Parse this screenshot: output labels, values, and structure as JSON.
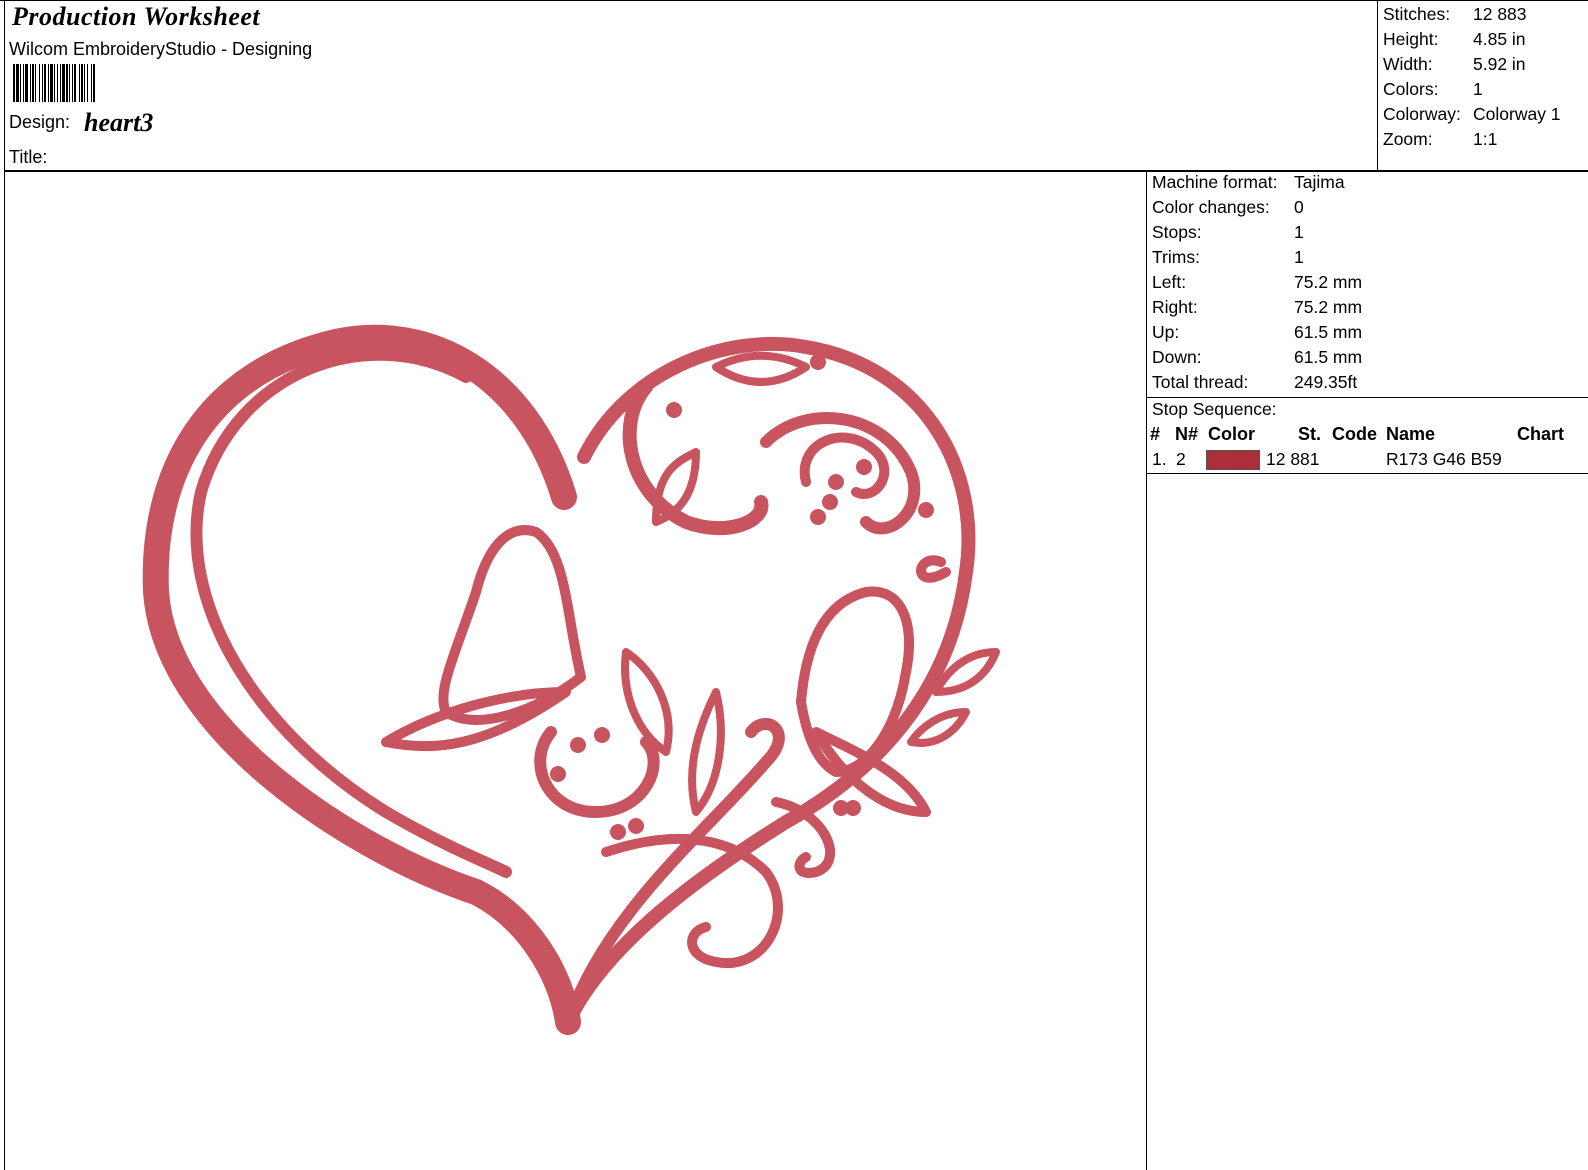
{
  "header": {
    "title": "Production Worksheet",
    "app": "Wilcom EmbroideryStudio - Designing",
    "design_label": "Design:",
    "design_value": "heart3",
    "title_label": "Title:"
  },
  "summary": [
    {
      "label": "Stitches:",
      "value": "12 883"
    },
    {
      "label": "Height:",
      "value": "4.85 in"
    },
    {
      "label": "Width:",
      "value": "5.92 in"
    },
    {
      "label": "Colors:",
      "value": "1"
    },
    {
      "label": "Colorway:",
      "value": "Colorway 1"
    },
    {
      "label": "Zoom:",
      "value": "1:1"
    }
  ],
  "machine_info": [
    {
      "label": "Machine format:",
      "value": "Tajima"
    },
    {
      "label": "Color changes:",
      "value": "0"
    },
    {
      "label": "Stops:",
      "value": "1"
    },
    {
      "label": "Trims:",
      "value": "1"
    },
    {
      "label": "Left:",
      "value": "75.2 mm"
    },
    {
      "label": "Right:",
      "value": "75.2 mm"
    },
    {
      "label": "Up:",
      "value": "61.5 mm"
    },
    {
      "label": "Down:",
      "value": "61.5 mm"
    },
    {
      "label": "Total thread:",
      "value": "249.35ft"
    }
  ],
  "stop_sequence": {
    "title": "Stop Sequence:",
    "headers": [
      "#",
      "N#",
      "Color",
      "St.",
      "Code",
      "Name",
      "Chart"
    ],
    "rows": [
      {
        "index": "1.",
        "needle": "2",
        "color": "#ad2e3b",
        "stitches": "12 881",
        "code": "",
        "name": "R173 G46 B59",
        "chart": ""
      }
    ]
  },
  "design": {
    "thread_color": "#c8545f",
    "shadow_color": "#9e3540",
    "motifs": [
      "heart-outline",
      "butterfly",
      "butterfly",
      "swirl",
      "leaf",
      "dot"
    ]
  }
}
